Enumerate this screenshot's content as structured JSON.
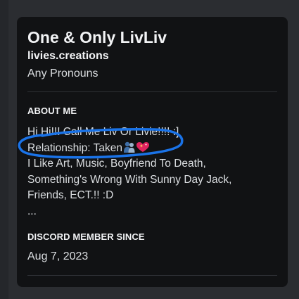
{
  "profile": {
    "display_name": "One & Only LivLiv",
    "username": "livies.creations",
    "pronouns": "Any Pronouns"
  },
  "about_me": {
    "heading": "ABOUT ME",
    "lines": [
      "Hi Hi!!! Call Me Liv Or Livie!!!! :]",
      "Relationship: Taken",
      "I Like Art, Music, Boyfriend To Death,",
      "Something's Wrong With Sunny Day Jack,",
      "Friends, ECT.!! :D",
      "..."
    ],
    "emojis": [
      "couple-silhouette-icon",
      "sparkling-heart-icon"
    ]
  },
  "member_since": {
    "heading": "DISCORD MEMBER SINCE",
    "date": "Aug 7, 2023"
  },
  "colors": {
    "background": "#2b2d31",
    "card": "#111214",
    "text_primary": "#f2f3f5",
    "text_secondary": "#dbdee1",
    "annotation_circle": "#1a73e8",
    "heart": "#e0245e"
  }
}
